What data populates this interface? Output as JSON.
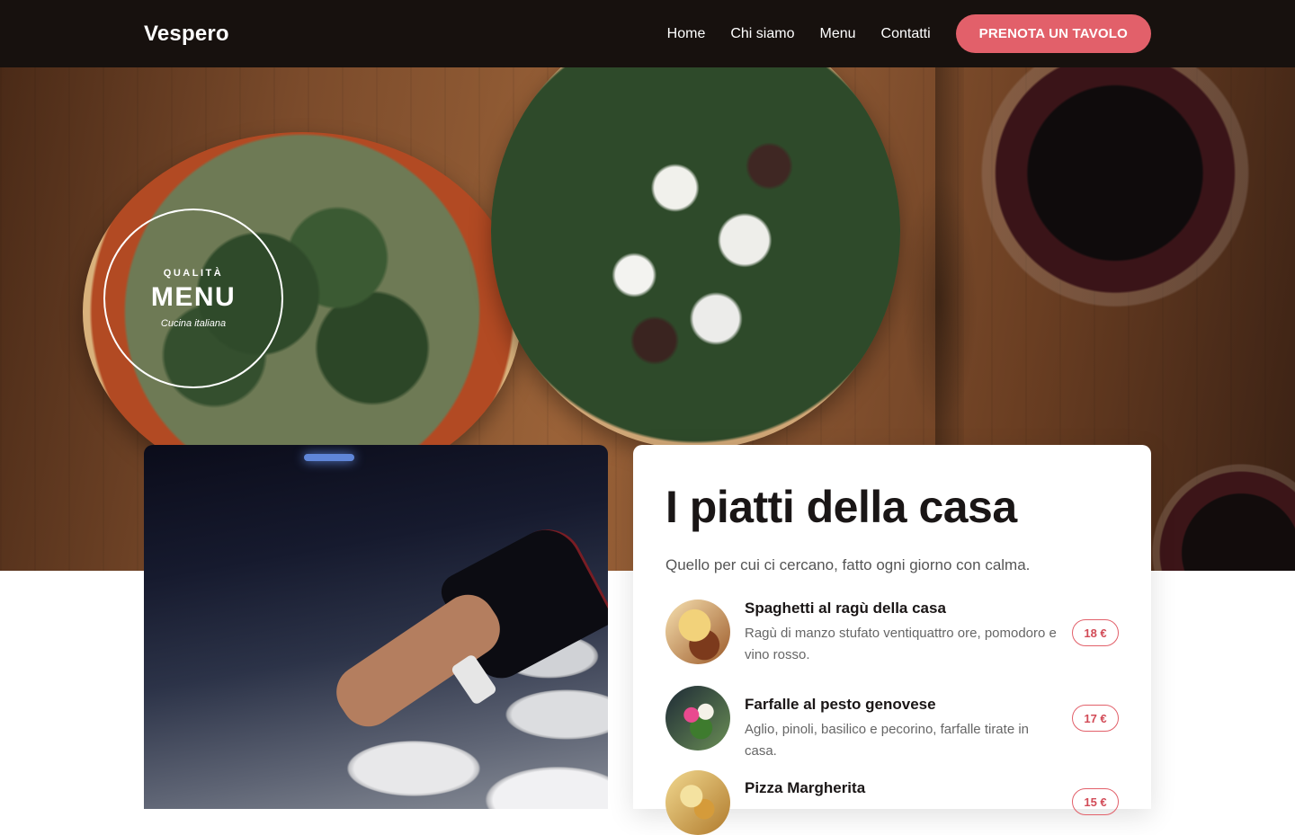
{
  "header": {
    "brand": "Vespero",
    "nav": [
      "Home",
      "Chi siamo",
      "Menu",
      "Contatti"
    ],
    "cta": "PRENOTA UN TAVOLO"
  },
  "hero": {
    "badge": {
      "eyebrow": "QUALITÀ",
      "title": "MENU",
      "subtitle": "Cucina italiana"
    }
  },
  "menu": {
    "title": "I piatti della casa",
    "subtitle": "Quello per cui ci cercano, fatto ogni giorno con calma.",
    "dishes": [
      {
        "name": "Spaghetti al ragù della casa",
        "description": "Ragù di manzo stufato ventiquattro ore, pomodoro e vino rosso.",
        "price": "18 €"
      },
      {
        "name": "Farfalle al pesto genovese",
        "description": "Aglio, pinoli, basilico e pecorino, farfalle tirate in casa.",
        "price": "17 €"
      },
      {
        "name": "Pizza Margherita",
        "description": "",
        "price": "15 €"
      }
    ]
  },
  "colors": {
    "accent": "#e2606a",
    "header_bg": "#17110e",
    "price_text": "#d24b57"
  }
}
